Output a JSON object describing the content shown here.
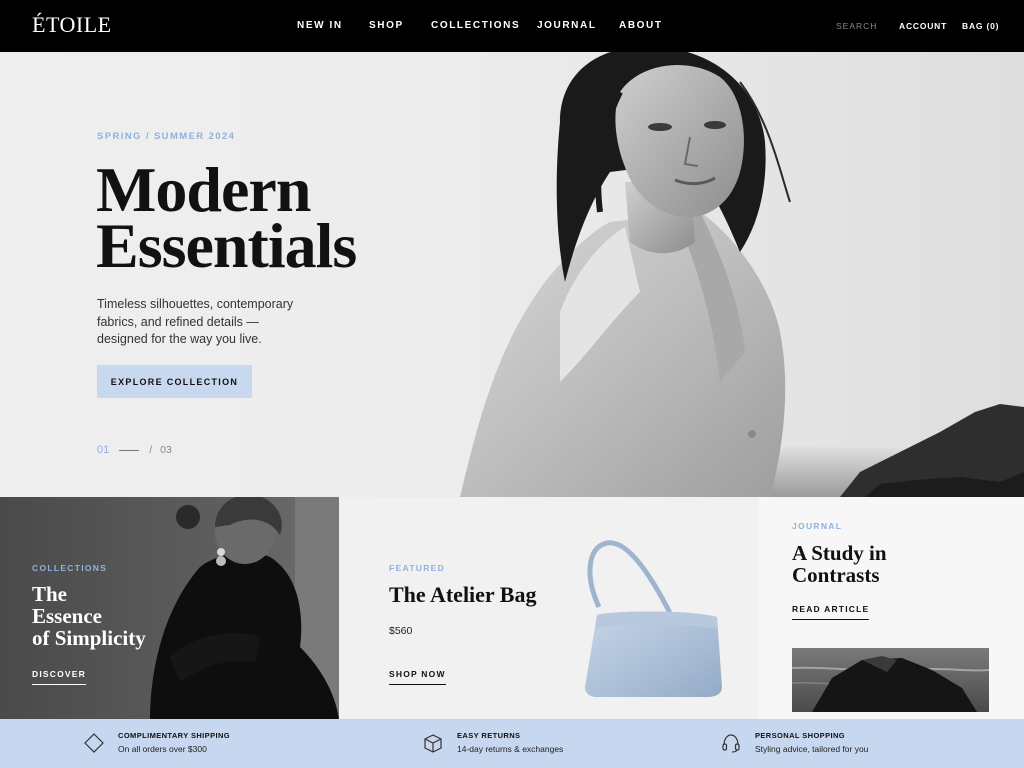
{
  "brand": {
    "logo": "ÉTOILE"
  },
  "nav": {
    "links": [
      "NEW IN",
      "SHOP",
      "COLLECTIONS",
      "JOURNAL",
      "ABOUT"
    ],
    "search_label": "SEARCH",
    "account_label": "ACCOUNT",
    "bag_label": "BAG (0)"
  },
  "hero": {
    "eyebrow": "SPRING / SUMMER 2024",
    "title_line1": "Modern",
    "title_line2": "Essentials",
    "copy": "Timeless silhouettes, contemporary fabrics, and refined details — designed for the way you live.",
    "cta": "EXPLORE COLLECTION",
    "pager_current": "01",
    "pager_sep": "/",
    "pager_total": "03"
  },
  "tiles": {
    "collections": {
      "eyebrow": "COLLECTIONS",
      "title_line1": "The",
      "title_line2": "Essence",
      "title_line3": "of Simplicity",
      "link": "DISCOVER"
    },
    "featured": {
      "eyebrow": "FEATURED",
      "title": "The Atelier Bag",
      "price": "$560",
      "link": "SHOP NOW"
    },
    "journal": {
      "eyebrow": "JOURNAL",
      "title_line1": "A Study in",
      "title_line2": "Contrasts",
      "link": "READ ARTICLE"
    }
  },
  "features": [
    {
      "icon": "tag-icon",
      "title": "COMPLIMENTARY SHIPPING",
      "sub": "On all orders over $300"
    },
    {
      "icon": "box-icon",
      "title": "EASY RETURNS",
      "sub": "14-day returns & exchanges"
    },
    {
      "icon": "headset-icon",
      "title": "PERSONAL SHOPPING",
      "sub": "Styling advice, tailored for you"
    }
  ],
  "colors": {
    "accent_blue": "#8fb1e0",
    "button_blue": "#c8d8ef",
    "strip_blue": "#c6d7ef",
    "nav_black": "#000000"
  }
}
